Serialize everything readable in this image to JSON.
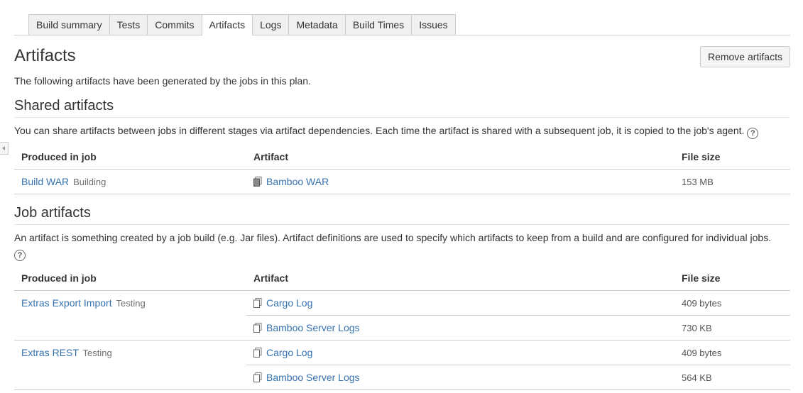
{
  "tabs": [
    {
      "label": "Build summary",
      "active": false
    },
    {
      "label": "Tests",
      "active": false
    },
    {
      "label": "Commits",
      "active": false
    },
    {
      "label": "Artifacts",
      "active": true
    },
    {
      "label": "Logs",
      "active": false
    },
    {
      "label": "Metadata",
      "active": false
    },
    {
      "label": "Build Times",
      "active": false
    },
    {
      "label": "Issues",
      "active": false
    }
  ],
  "page": {
    "title": "Artifacts",
    "remove_button": "Remove artifacts",
    "intro": "The following artifacts have been generated by the jobs in this plan."
  },
  "shared": {
    "heading": "Shared artifacts",
    "description": "You can share artifacts between jobs in different stages via artifact dependencies. Each time the artifact is shared with a subsequent job, it is copied to the job's agent.",
    "columns": [
      "Produced in job",
      "Artifact",
      "File size"
    ],
    "rows": [
      {
        "job": "Build WAR",
        "status": "Building",
        "artifact": "Bamboo WAR",
        "size": "153 MB"
      }
    ]
  },
  "job": {
    "heading": "Job artifacts",
    "description": "An artifact is something created by a job build (e.g. Jar files). Artifact definitions are used to specify which artifacts to keep from a build and are configured for individual jobs.",
    "columns": [
      "Produced in job",
      "Artifact",
      "File size"
    ],
    "rows": [
      {
        "job": "Extras Export Import",
        "status": "Testing",
        "artifacts": [
          {
            "name": "Cargo Log",
            "size": "409 bytes"
          },
          {
            "name": "Bamboo Server Logs",
            "size": "730 KB"
          }
        ]
      },
      {
        "job": "Extras REST",
        "status": "Testing",
        "artifacts": [
          {
            "name": "Cargo Log",
            "size": "409 bytes"
          },
          {
            "name": "Bamboo Server Logs",
            "size": "564 KB"
          }
        ]
      }
    ]
  },
  "icons": {
    "shared_artifact": "shared-artifact-icon",
    "artifact": "artifact-file-icon",
    "help": "help-icon",
    "collapse": "collapse-sidebar-icon"
  },
  "colors": {
    "link": "#3572b0",
    "border": "#cccccc",
    "tab_bg": "#f0f0f0"
  }
}
